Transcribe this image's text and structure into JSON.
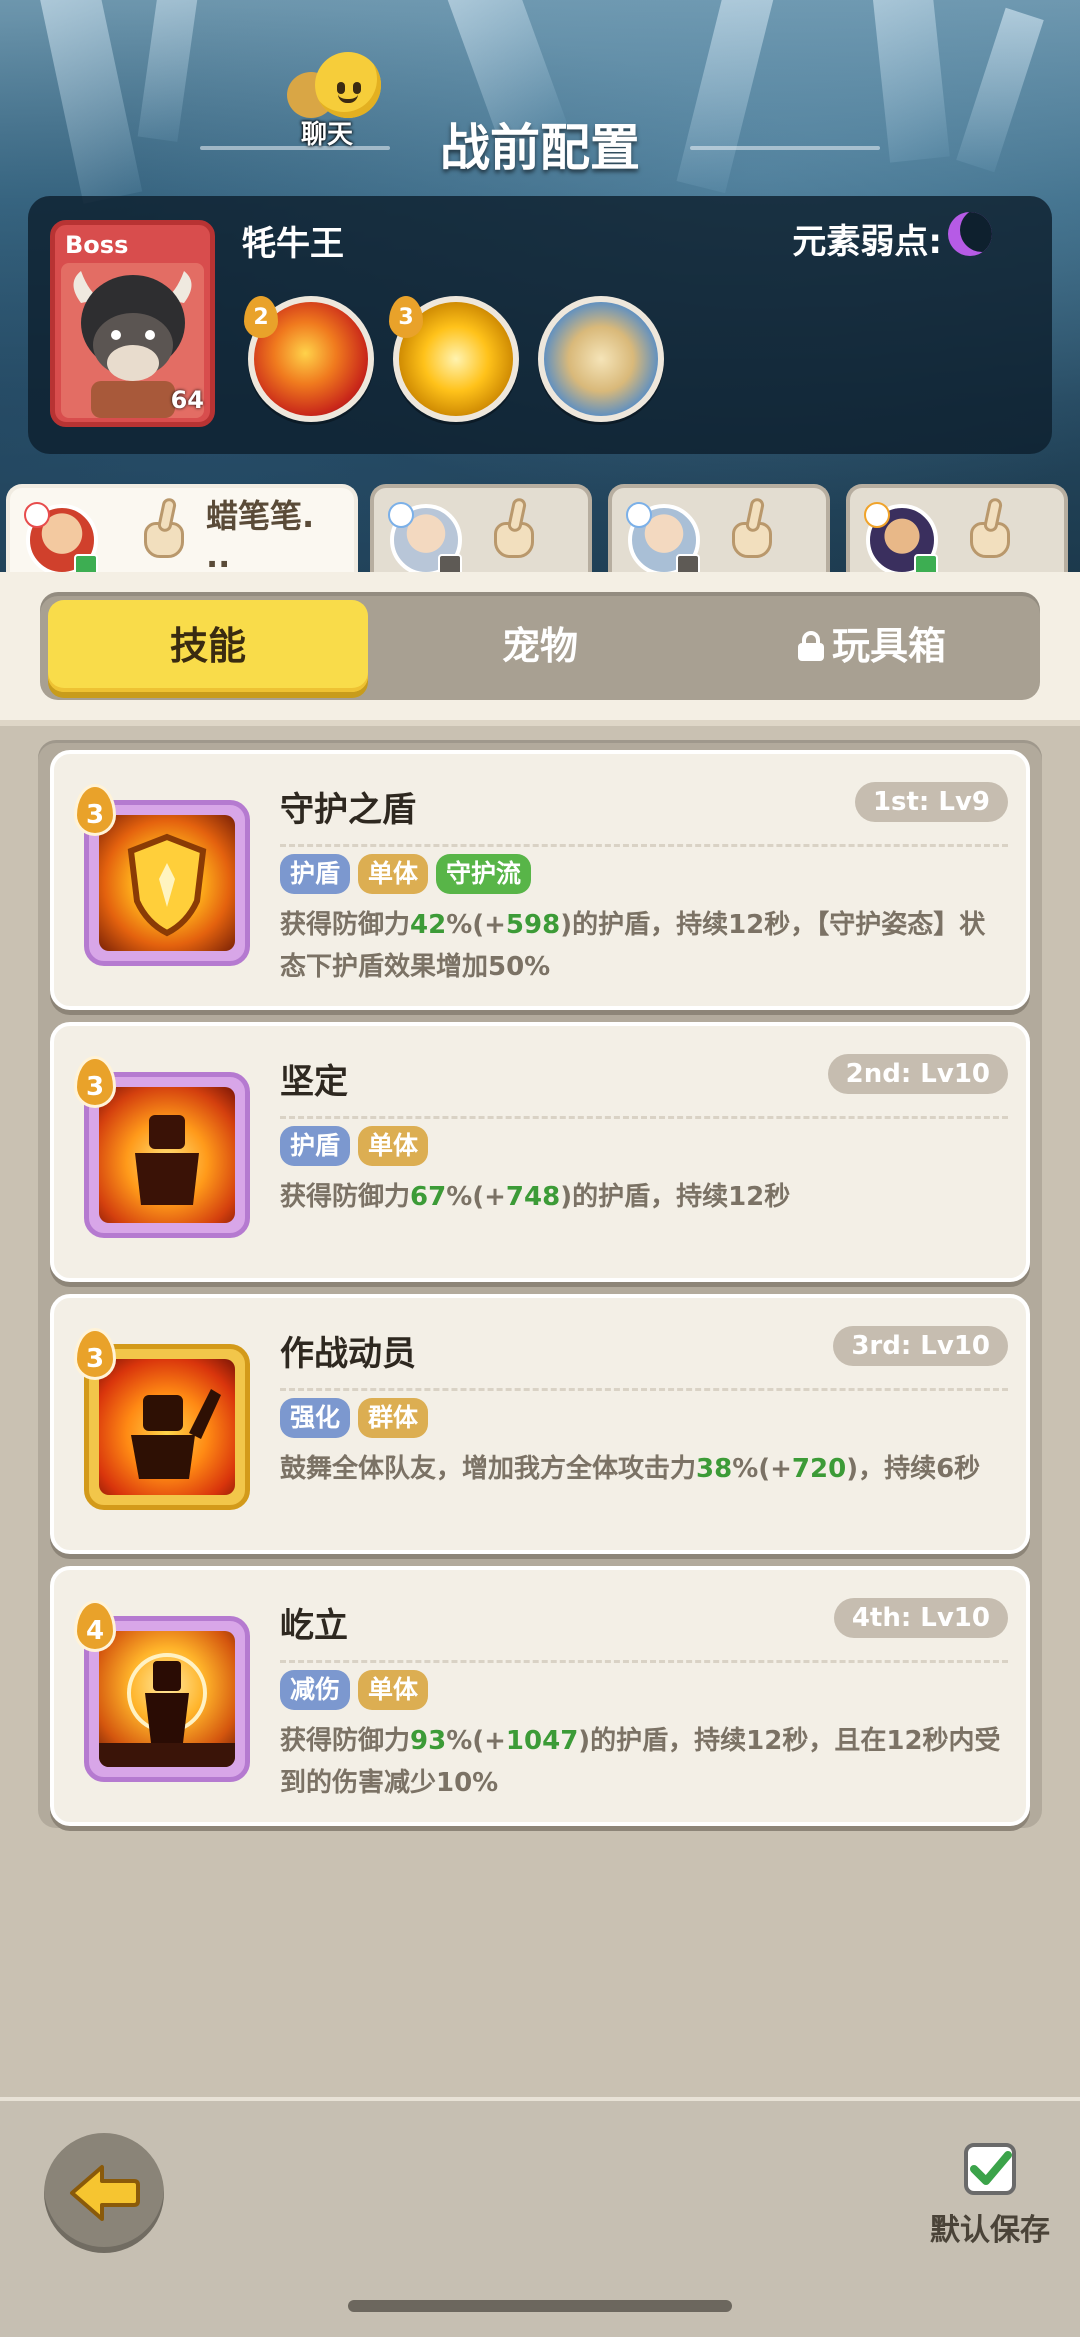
{
  "header": {
    "title": "战前配置",
    "chat_label": "聊天"
  },
  "boss": {
    "tag": "Boss",
    "level": "64",
    "name": "牦牛王",
    "weakness_label": "元素弱点:",
    "weakness_icon": "moon-icon",
    "skills": [
      {
        "icon": "fire-claw-icon",
        "count": "2"
      },
      {
        "icon": "golden-ring-icon",
        "count": "3"
      },
      {
        "icon": "rock-shield-icon",
        "count": ""
      }
    ]
  },
  "heroes": [
    {
      "name": "蜡笔笔.\n..",
      "status": "green",
      "active": true
    },
    {
      "name": "",
      "status": "gray",
      "active": false
    },
    {
      "name": "",
      "status": "gray",
      "active": false
    },
    {
      "name": "",
      "status": "green",
      "active": false
    }
  ],
  "tabs": {
    "skills": "技能",
    "pets": "宠物",
    "toybox": "玩具箱"
  },
  "skills": [
    {
      "title": "守护之盾",
      "rank": "1st: Lv9",
      "cost": "3",
      "icon": "golden-shield-icon",
      "tags": [
        {
          "label": "护盾",
          "color": "blue"
        },
        {
          "label": "单体",
          "color": "gold"
        },
        {
          "label": "守护流",
          "color": "green"
        }
      ],
      "desc_parts": [
        "获得防御力",
        "42",
        "%(+",
        "598",
        ")的护盾，持续12秒，【守护姿态】状态下护盾效果增加50%"
      ]
    },
    {
      "title": "坚定",
      "rank": "2nd: Lv10",
      "cost": "3",
      "icon": "steadfast-figure-icon",
      "tags": [
        {
          "label": "护盾",
          "color": "blue"
        },
        {
          "label": "单体",
          "color": "gold"
        }
      ],
      "desc_parts": [
        "获得防御力",
        "67",
        "%(+",
        "748",
        ")的护盾，持续12秒"
      ]
    },
    {
      "title": "作战动员",
      "rank": "3rd: Lv10",
      "cost": "3",
      "icon": "rally-figure-icon",
      "tags": [
        {
          "label": "强化",
          "color": "blue"
        },
        {
          "label": "群体",
          "color": "gold"
        }
      ],
      "desc_parts": [
        "鼓舞全体队友，增加我方全体攻击力",
        "38",
        "%(+",
        "720",
        ")，持续6秒"
      ]
    },
    {
      "title": "屹立",
      "rank": "4th: Lv10",
      "cost": "4",
      "icon": "standing-figure-icon",
      "tags": [
        {
          "label": "减伤",
          "color": "blue"
        },
        {
          "label": "单体",
          "color": "gold"
        }
      ],
      "desc_parts": [
        "获得防御力",
        "93",
        "%(+",
        "1047",
        ")的护盾，持续12秒，且在12秒内受到的伤害减少10%"
      ]
    }
  ],
  "footer": {
    "save_label": "默认保存",
    "save_checked": true
  },
  "colors": {
    "accent_yellow": "#f9dc4a",
    "highlight_green": "#3c9b37",
    "tag_blue": "#7c98cf",
    "tag_gold": "#dcae52",
    "tag_green": "#58b548"
  }
}
